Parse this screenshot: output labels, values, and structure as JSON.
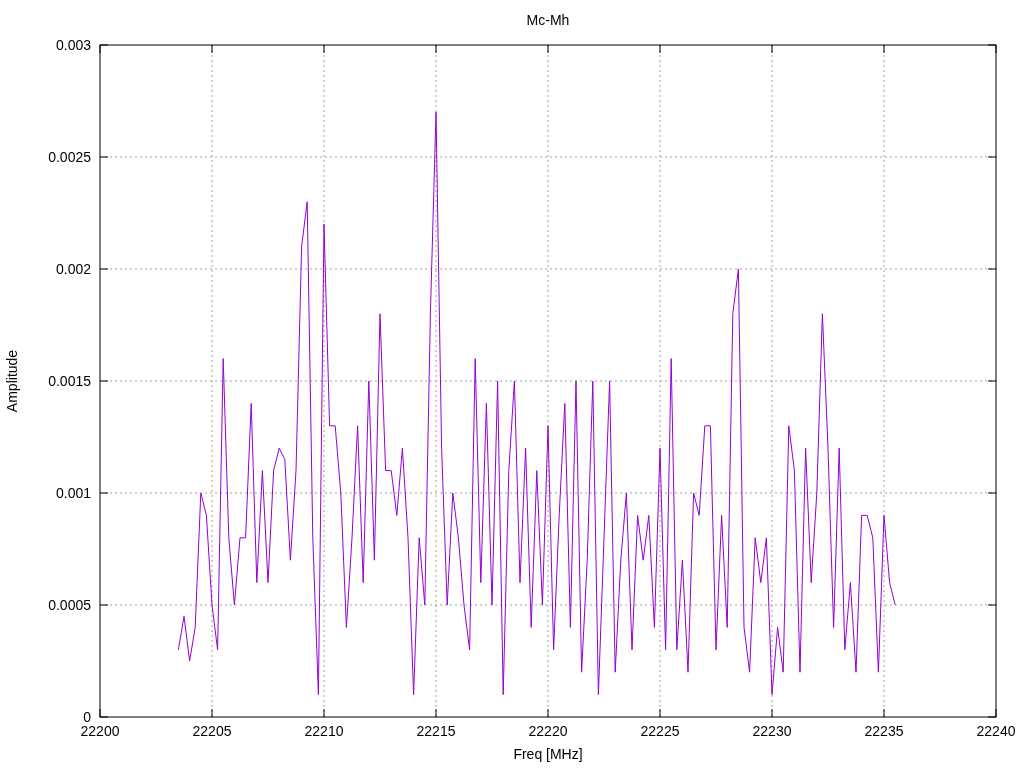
{
  "chart_data": {
    "type": "line",
    "title": "Mc-Mh",
    "xlabel": "Freq [MHz]",
    "ylabel": "Amplitude",
    "grid": true,
    "xlim": [
      22200,
      22240
    ],
    "ylim": [
      0,
      0.003
    ],
    "xticks": [
      {
        "value": 22200,
        "label": "22200"
      },
      {
        "value": 22205,
        "label": "22205"
      },
      {
        "value": 22210,
        "label": "22210"
      },
      {
        "value": 22215,
        "label": "22215"
      },
      {
        "value": 22220,
        "label": "22220"
      },
      {
        "value": 22225,
        "label": "22225"
      },
      {
        "value": 22230,
        "label": "22230"
      },
      {
        "value": 22235,
        "label": "22235"
      },
      {
        "value": 22240,
        "label": "22240"
      }
    ],
    "yticks": [
      {
        "value": 0,
        "label": "0"
      },
      {
        "value": 0.0005,
        "label": "0.0005"
      },
      {
        "value": 0.001,
        "label": "0.001"
      },
      {
        "value": 0.0015,
        "label": "0.0015"
      },
      {
        "value": 0.002,
        "label": "0.002"
      },
      {
        "value": 0.0025,
        "label": "0.0025"
      },
      {
        "value": 0.003,
        "label": "0.003"
      }
    ],
    "x": [
      22203.5,
      22203.75,
      22204,
      22204.25,
      22204.5,
      22204.75,
      22205,
      22205.25,
      22205.5,
      22205.75,
      22206,
      22206.25,
      22206.5,
      22206.75,
      22207,
      22207.25,
      22207.5,
      22207.75,
      22208,
      22208.25,
      22208.5,
      22208.75,
      22209,
      22209.25,
      22209.5,
      22209.75,
      22210,
      22210.25,
      22210.5,
      22210.75,
      22211,
      22211.25,
      22211.5,
      22211.75,
      22212,
      22212.25,
      22212.5,
      22212.75,
      22213,
      22213.25,
      22213.5,
      22213.75,
      22214,
      22214.25,
      22214.5,
      22214.75,
      22215,
      22215.25,
      22215.5,
      22215.75,
      22216,
      22216.25,
      22216.5,
      22216.75,
      22217,
      22217.25,
      22217.5,
      22217.75,
      22218,
      22218.25,
      22218.5,
      22218.75,
      22219,
      22219.25,
      22219.5,
      22219.75,
      22220,
      22220.25,
      22220.5,
      22220.75,
      22221,
      22221.25,
      22221.5,
      22221.75,
      22222,
      22222.25,
      22222.5,
      22222.75,
      22223,
      22223.25,
      22223.5,
      22223.75,
      22224,
      22224.25,
      22224.5,
      22224.75,
      22225,
      22225.25,
      22225.5,
      22225.75,
      22226,
      22226.25,
      22226.5,
      22226.75,
      22227,
      22227.25,
      22227.5,
      22227.75,
      22228,
      22228.25,
      22228.5,
      22228.75,
      22229,
      22229.25,
      22229.5,
      22229.75,
      22230,
      22230.25,
      22230.5,
      22230.75,
      22231,
      22231.25,
      22231.5,
      22231.75,
      22232,
      22232.25,
      22232.5,
      22232.75,
      22233,
      22233.25,
      22233.5,
      22233.75,
      22234,
      22234.25,
      22234.5,
      22234.75,
      22235,
      22235.25,
      22235.5
    ],
    "series": [
      {
        "color": "#9400d3",
        "values": [
          0.0003,
          0.00045,
          0.00025,
          0.0004,
          0.001,
          0.0009,
          0.0005,
          0.0003,
          0.0016,
          0.0008,
          0.0005,
          0.0008,
          0.0008,
          0.0014,
          0.0006,
          0.0011,
          0.0006,
          0.0011,
          0.0012,
          0.00115,
          0.0007,
          0.0011,
          0.0021,
          0.0023,
          0.0008,
          0.0001,
          0.0022,
          0.0013,
          0.0013,
          0.001,
          0.0004,
          0.0008,
          0.0013,
          0.0006,
          0.0015,
          0.0007,
          0.0018,
          0.0011,
          0.0011,
          0.0009,
          0.0012,
          0.0008,
          0.0001,
          0.0008,
          0.0005,
          0.0018,
          0.0027,
          0.0012,
          0.0005,
          0.001,
          0.0008,
          0.0005,
          0.0003,
          0.0016,
          0.0006,
          0.0014,
          0.0005,
          0.0015,
          0.0001,
          0.0011,
          0.0015,
          0.0006,
          0.0012,
          0.0004,
          0.0011,
          0.0005,
          0.0013,
          0.0003,
          0.0009,
          0.0014,
          0.0004,
          0.0015,
          0.0002,
          0.0007,
          0.0015,
          0.0001,
          0.0008,
          0.0015,
          0.0002,
          0.0007,
          0.001,
          0.0003,
          0.0009,
          0.0007,
          0.0009,
          0.0004,
          0.0012,
          0.0003,
          0.0016,
          0.0003,
          0.0007,
          0.0002,
          0.001,
          0.0009,
          0.0013,
          0.0013,
          0.0003,
          0.0009,
          0.0004,
          0.0018,
          0.002,
          0.0004,
          0.0002,
          0.0008,
          0.0006,
          0.0008,
          0.0001,
          0.0004,
          0.0002,
          0.0013,
          0.0011,
          0.0002,
          0.0012,
          0.0006,
          0.001,
          0.0018,
          0.0012,
          0.0004,
          0.0012,
          0.0003,
          0.0006,
          0.0002,
          0.0009,
          0.0009,
          0.0008,
          0.0002,
          0.0009,
          0.0006,
          0.0005
        ]
      }
    ]
  }
}
